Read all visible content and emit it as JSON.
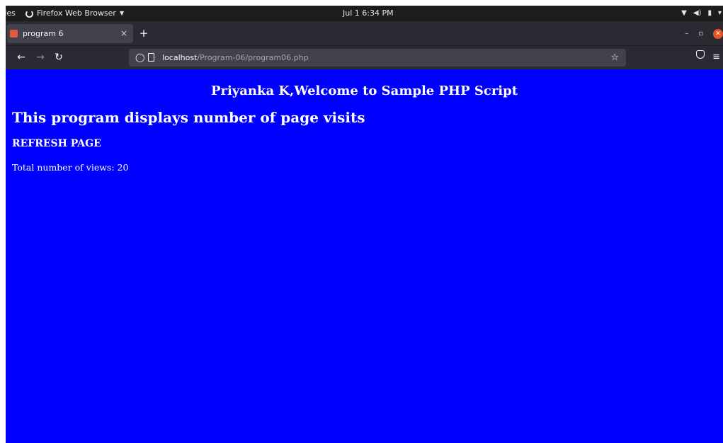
{
  "system_bar": {
    "activities_label": "ties",
    "app_name": "Firefox Web Browser",
    "clock": "Jul 1  6:34 PM"
  },
  "browser": {
    "tab_title": "program 6",
    "tab_close": "×",
    "new_tab": "+",
    "url_host": "localhost",
    "url_path": "/Program-06/program06.php"
  },
  "page": {
    "title": "Priyanka K,Welcome to Sample PHP Script",
    "heading": "This program displays number of page visits",
    "refresh_label": "REFRESH PAGE",
    "views_text": "Total number of views: 20",
    "background_color": "#0000ff",
    "text_color": "#ffffff"
  }
}
